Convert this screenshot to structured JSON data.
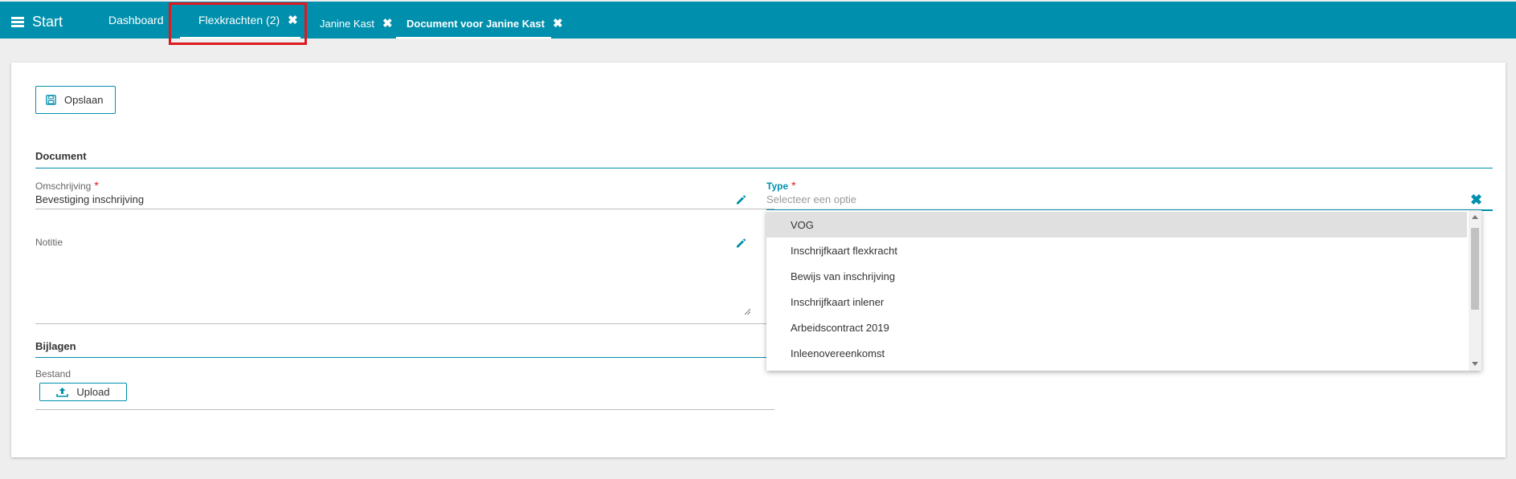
{
  "topbar": {
    "start_label": "Start",
    "tabs": [
      {
        "label": "Dashboard",
        "closable": false
      },
      {
        "label": "Flexkrachten (2)",
        "closable": true
      },
      {
        "label": "Janine Kast",
        "closable": true
      },
      {
        "label": "Document voor Janine Kast",
        "closable": true
      }
    ],
    "close_glyph": "✖"
  },
  "toolbar": {
    "save_label": "Opslaan"
  },
  "document_section": {
    "title": "Document",
    "omschrijving": {
      "label": "Omschrijving",
      "required_mark": "*",
      "value": "Bevestiging inschrijving"
    },
    "notitie": {
      "label": "Notitie",
      "value": ""
    },
    "type": {
      "label": "Type",
      "required_mark": "*",
      "placeholder": "Selecteer een optie",
      "clear_glyph": "✖"
    }
  },
  "bijlagen_section": {
    "title": "Bijlagen",
    "bestand_label": "Bestand",
    "upload_label": "Upload"
  },
  "type_dropdown": {
    "options": [
      "VOG",
      "Inschrijfkaart flexkracht",
      "Bewijs van inschrijving",
      "Inschrijfkaart inlener",
      "Arbeidscontract 2019",
      "Inleenovereenkomst"
    ],
    "highlighted_index": 0
  },
  "colors": {
    "brand": "#0090ad",
    "required": "#e0191e",
    "highlight_box": "#e0191e"
  }
}
